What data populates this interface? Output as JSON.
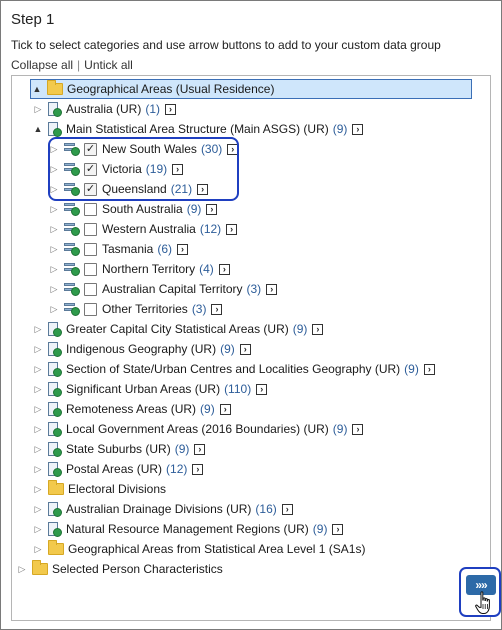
{
  "step_title": "Step 1",
  "instructions": "Tick to select categories and use arrow buttons to add to your custom data group",
  "links": {
    "collapse_all": "Collapse all",
    "separator": "|",
    "untick_all": "Untick all"
  },
  "add_arrow": "›",
  "check_mark": "✓",
  "go_button": "»»",
  "tree": {
    "root": {
      "label": "Geographical Areas (Usual Residence)",
      "expander": "▲"
    },
    "australia": {
      "label": "Australia (UR)",
      "count": "(1)",
      "expander": "▷"
    },
    "main_asgs": {
      "label": "Main Statistical Area Structure (Main ASGS) (UR)",
      "count": "(9)",
      "expander": "▲"
    },
    "states": [
      {
        "label": "New South Wales",
        "count": "(30)",
        "checked": true
      },
      {
        "label": "Victoria",
        "count": "(19)",
        "checked": true
      },
      {
        "label": "Queensland",
        "count": "(21)",
        "checked": true
      },
      {
        "label": "South Australia",
        "count": "(9)",
        "checked": false
      },
      {
        "label": "Western Australia",
        "count": "(12)",
        "checked": false
      },
      {
        "label": "Tasmania",
        "count": "(6)",
        "checked": false
      },
      {
        "label": "Northern Territory",
        "count": "(4)",
        "checked": false
      },
      {
        "label": "Australian Capital Territory",
        "count": "(3)",
        "checked": false
      },
      {
        "label": "Other Territories",
        "count": "(3)",
        "checked": false
      }
    ],
    "others": [
      {
        "label": "Greater Capital City Statistical Areas (UR)",
        "count": "(9)"
      },
      {
        "label": "Indigenous Geography (UR)",
        "count": "(9)"
      },
      {
        "label": "Section of State/Urban Centres and Localities Geography (UR)",
        "count": "(9)"
      },
      {
        "label": "Significant Urban Areas (UR)",
        "count": "(110)"
      },
      {
        "label": "Remoteness Areas (UR)",
        "count": "(9)"
      },
      {
        "label": "Local Government Areas (2016 Boundaries) (UR)",
        "count": "(9)"
      },
      {
        "label": "State Suburbs (UR)",
        "count": "(9)"
      },
      {
        "label": "Postal Areas (UR)",
        "count": "(12)"
      }
    ],
    "electoral": {
      "label": "Electoral Divisions"
    },
    "drainage": {
      "label": "Australian Drainage Divisions (UR)",
      "count": "(16)"
    },
    "nrm": {
      "label": "Natural Resource Management Regions (UR)",
      "count": "(9)"
    },
    "sa1": {
      "label": "Geographical Areas from Statistical Area Level 1 (SA1s)"
    },
    "person": {
      "label": "Selected Person Characteristics"
    },
    "collapsed_expander": "▷"
  },
  "colors": {
    "accent": "#2d6aa8",
    "selection": "#cfe6fb",
    "highlight_outline": "#1f3fc0",
    "count_text": "#2d5d99"
  }
}
